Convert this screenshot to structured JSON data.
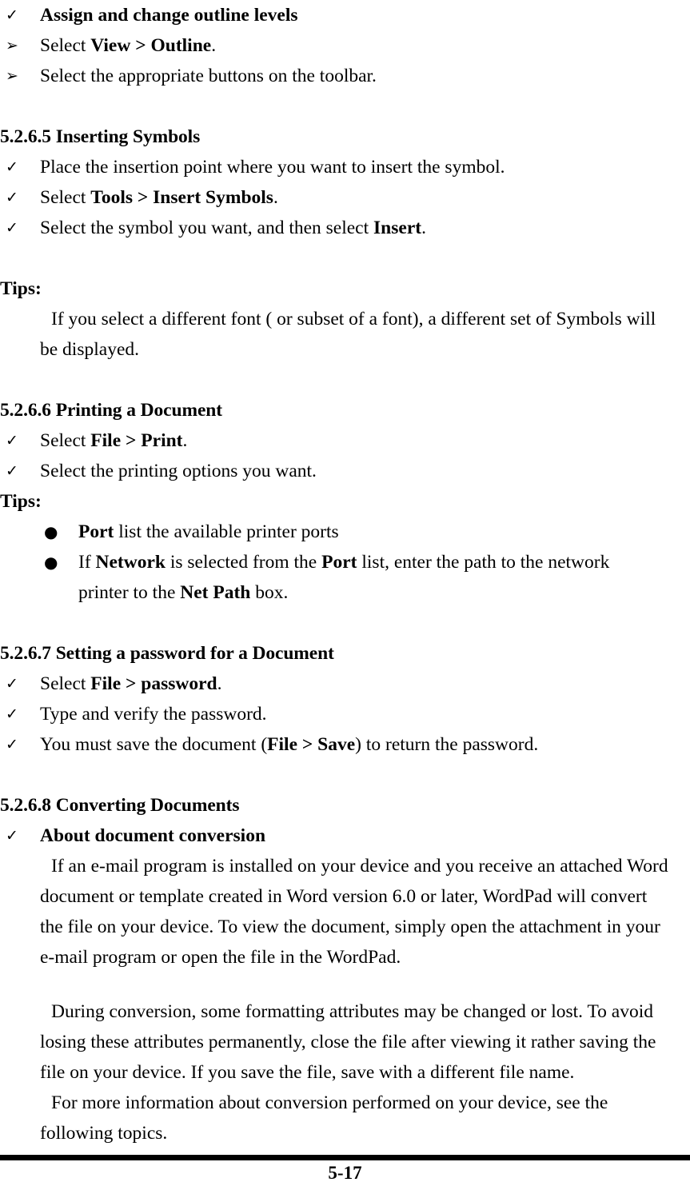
{
  "page": {
    "page_number": "5-17"
  },
  "icons": {
    "check": "✓",
    "arrow": "➢",
    "dot": "●"
  },
  "intro_list": [
    {
      "bullet": "check",
      "bold_lead": "Assign and change outline levels",
      "text": ""
    },
    {
      "bullet": "arrow",
      "prefix": "Select ",
      "bold": "View > Outline",
      "suffix": "."
    },
    {
      "bullet": "arrow",
      "prefix": "Select the appropriate buttons on the toolbar.",
      "bold": "",
      "suffix": ""
    }
  ],
  "sections": [
    {
      "heading": "5.2.6.5 Inserting Symbols",
      "items": [
        {
          "prefix": "Place the insertion point where you want to insert the symbol.",
          "bold": "",
          "suffix": ""
        },
        {
          "prefix": "Select ",
          "bold": "Tools > Insert Symbols",
          "suffix": "."
        },
        {
          "prefix": "Select the symbol you want, and then select ",
          "bold": "Insert",
          "suffix": "."
        }
      ],
      "tips_label": "Tips:",
      "tips_body": "If you select a different font ( or subset of a font), a different set of Symbols will be displayed."
    },
    {
      "heading": "5.2.6.6 Printing a Document",
      "items": [
        {
          "prefix": "Select ",
          "bold": "File > Print",
          "suffix": "."
        },
        {
          "prefix": "Select the printing options you want.",
          "bold": "",
          "suffix": ""
        }
      ],
      "tips_label": "Tips:",
      "dot_items": [
        {
          "bold1": "Port",
          "mid1": " list the available printer ports",
          "bold2": "",
          "mid2": "",
          "bold3": "",
          "tail": ""
        },
        {
          "bold1": "",
          "mid1": "If ",
          "bold2": "Network",
          "mid2": " is selected from the ",
          "bold3": "Port",
          "tail": " list, enter the path to the network printer to the ",
          "bold4": "Net Path",
          "tail2": " box."
        }
      ]
    },
    {
      "heading": "5.2.6.7 Setting a password for a Document",
      "items": [
        {
          "prefix": "Select ",
          "bold": "File > password",
          "suffix": "."
        },
        {
          "prefix": "Type and verify the password.",
          "bold": "",
          "suffix": ""
        },
        {
          "prefix": "You must save the document (",
          "bold": "File > Save",
          "suffix": ") to return the password."
        }
      ]
    },
    {
      "heading": "5.2.6.8 Converting Documents",
      "bold_item": "About document conversion",
      "paragraphs": [
        "If an e-mail program is installed on your device and you receive an attached Word document or template created in Word version 6.0 or later, WordPad will convert the file on your device. To view the document, simply open the attachment in your e-mail program or open the file in the WordPad.",
        "During conversion, some formatting attributes may be changed or lost. To avoid losing these attributes permanently, close the file after viewing it rather saving the file on your device. If you save the file, save with a different file name.",
        "For more information about conversion performed on your device, see the following topics."
      ]
    }
  ]
}
